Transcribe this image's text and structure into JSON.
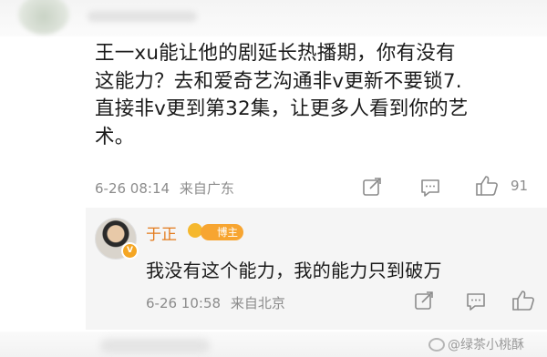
{
  "comment": {
    "text": "王一xu能让他的剧延长热播期，你有没有\n这能力？去和爱奇艺沟通非v更新不要锁7.\n直接非v更到第32集，让更多人看到你的艺\n术。",
    "time": "6-26 08:14",
    "location": "来自广东",
    "like_count": "91"
  },
  "reply": {
    "author": "于正",
    "badge": "博主",
    "text": "我没有这个能力，我的能力只到破万",
    "time": "6-26 10:58",
    "location": "来自北京"
  },
  "watermark": "@绿茶小桃酥",
  "icons": [
    "share-icon",
    "comment-icon",
    "like-icon",
    "verified-badge-icon",
    "crown-icon"
  ],
  "colors": {
    "author_name": "#e37b1d",
    "badge_bg": "#f7a531",
    "meta": "#8c8c8c"
  }
}
